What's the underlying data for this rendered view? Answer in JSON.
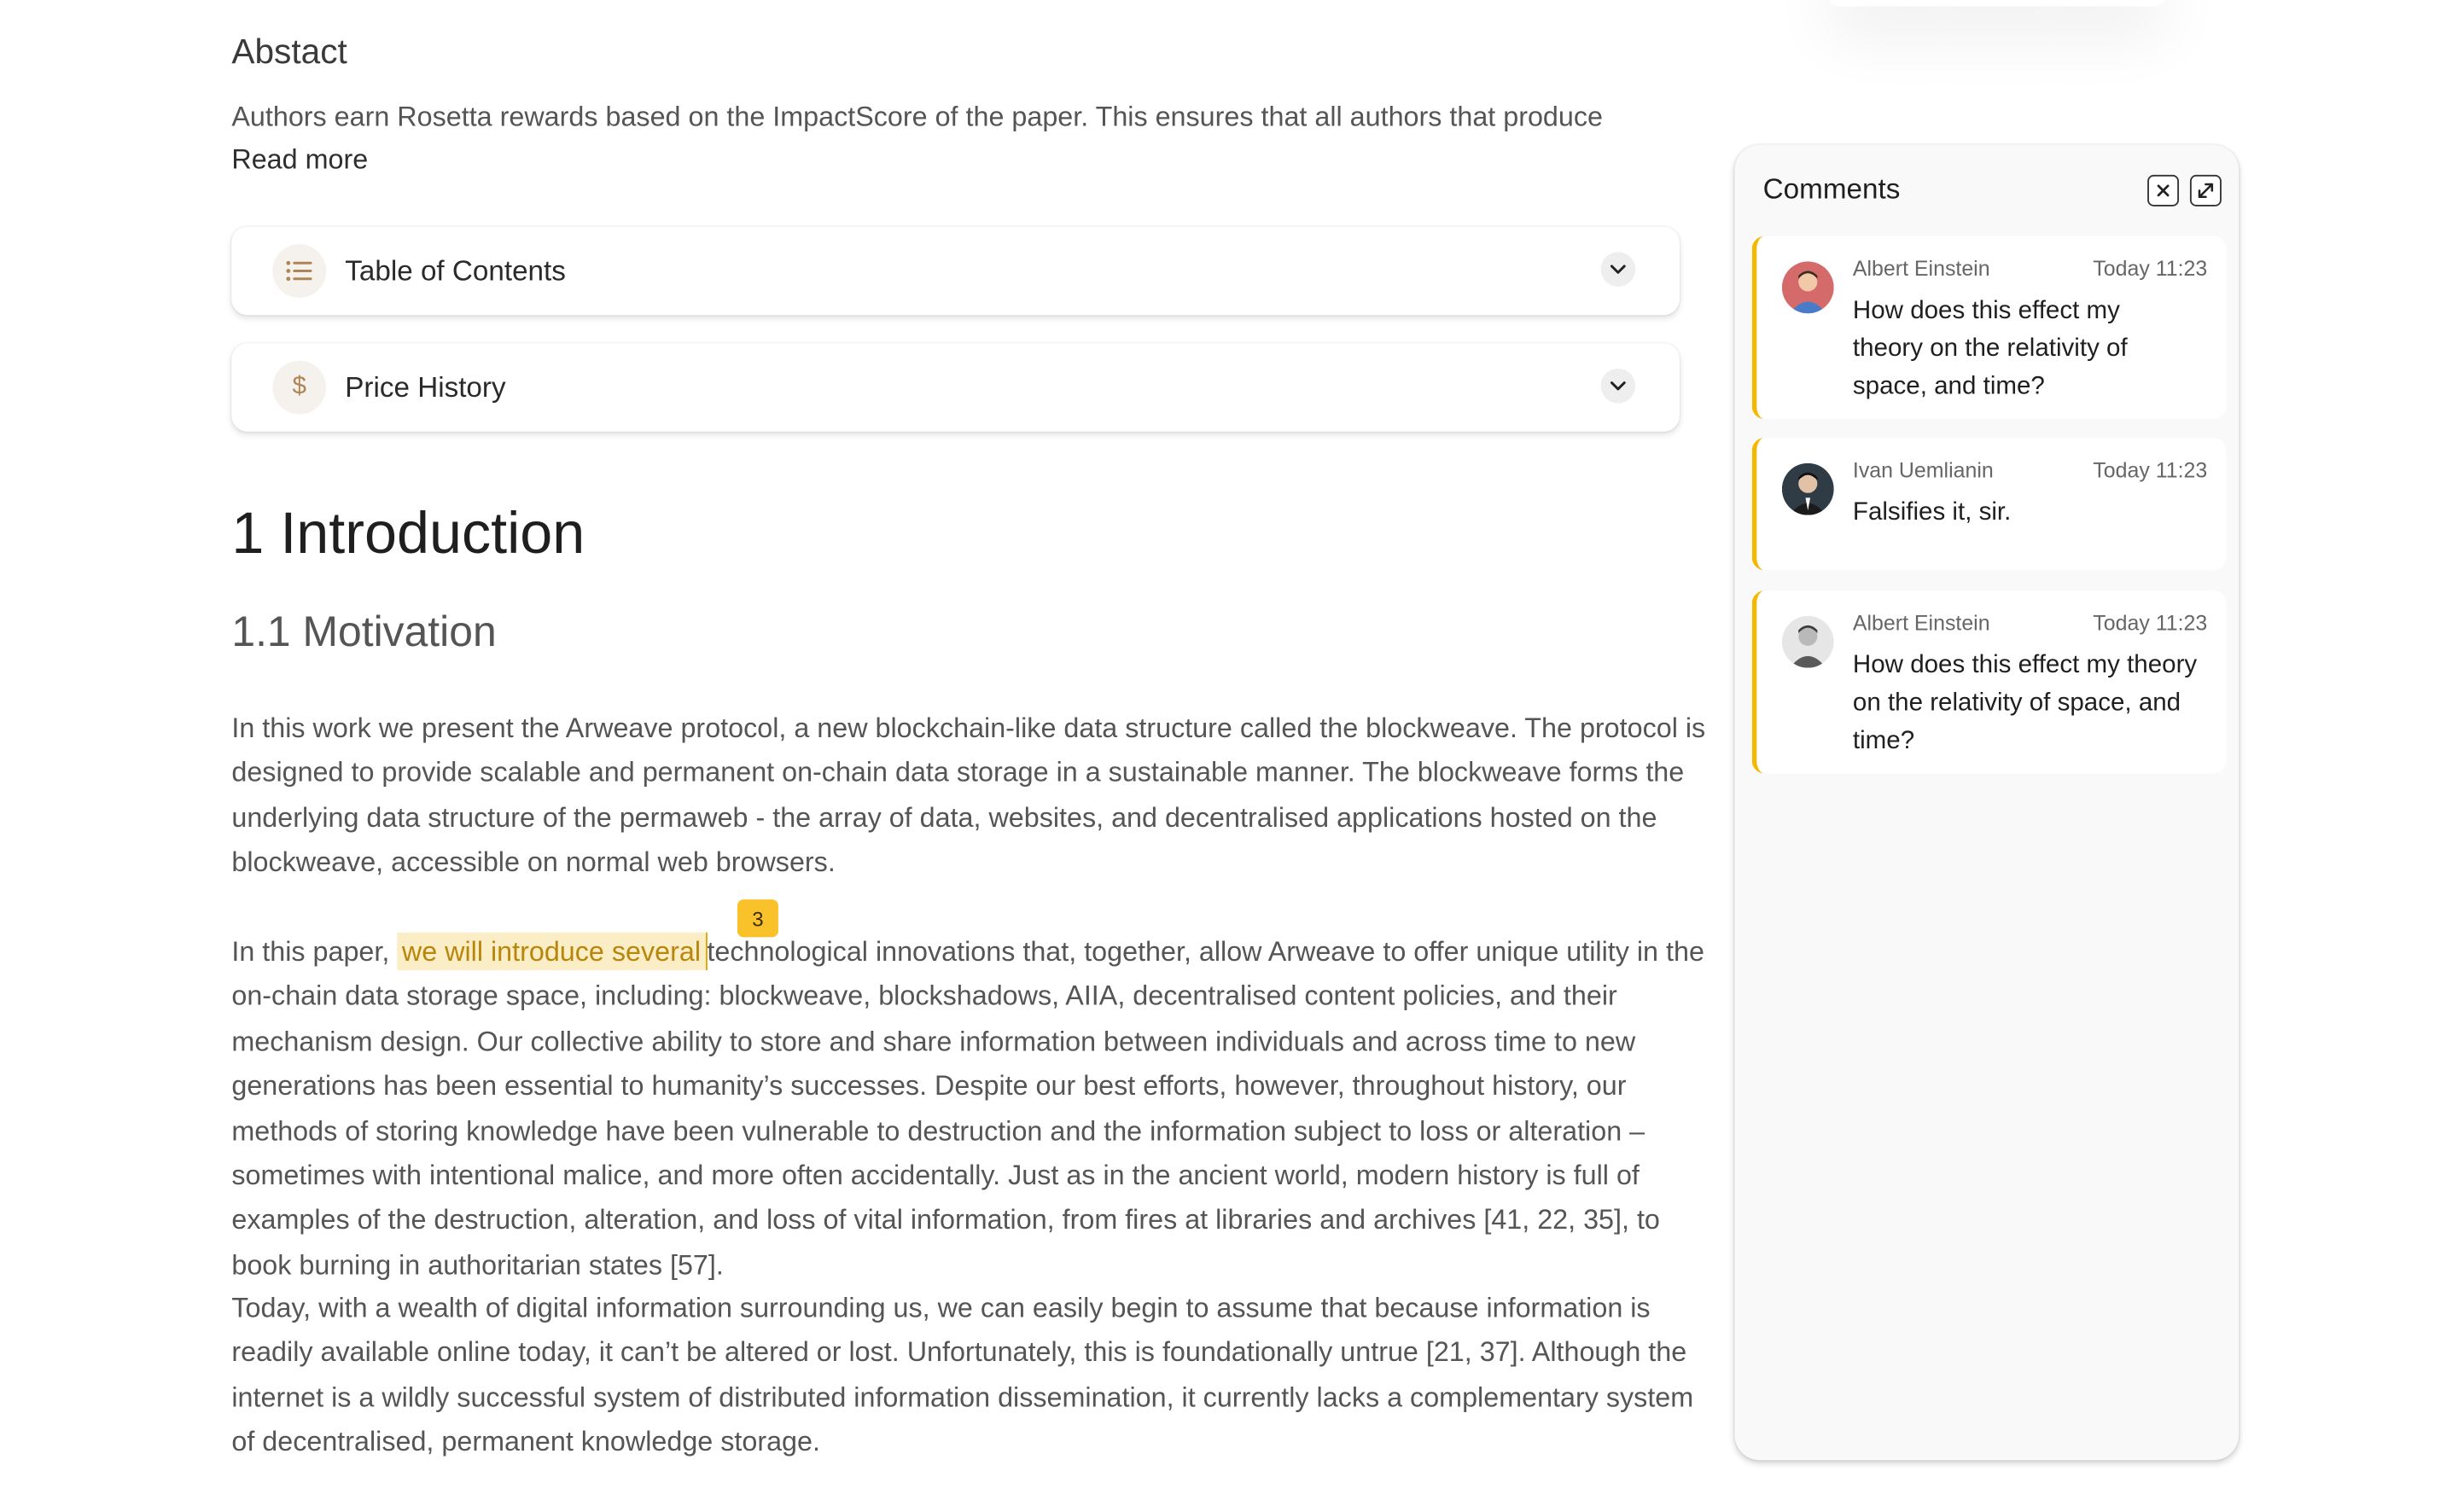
{
  "abstract": {
    "title": "Abstact",
    "text": "Authors earn Rosetta rewards based on the ImpactScore of the paper. This ensures that all authors that produce",
    "read_more": "Read more"
  },
  "accordions": [
    {
      "label": "Table of Contents",
      "icon": "list-icon"
    },
    {
      "label": "Price History",
      "icon": "dollar-icon",
      "icon_glyph": "$"
    }
  ],
  "article": {
    "heading": "1 Introduction",
    "subheading": "1.1 Motivation",
    "p1": "In this work we present the Arweave protocol, a new blockchain-like data structure called the blockweave. The protocol is designed to provide scalable and permanent on-chain data storage in a sustainable manner. The blockweave forms the underlying data structure of the permaweb - the array of data, websites, and decentralised applications hosted on the blockweave, accessible on normal web browsers.",
    "p2_before": "In this paper, ",
    "p2_highlight": "we will introduce several",
    "p2_after": "technological innovations that, together, allow Arweave to offer unique utility in the on-chain data storage space, including: blockweave, blockshadows, AIIA, decentralised content policies, and their mechanism design. Our collective ability to store and share information between individuals and across time to new generations has been essential to humanity’s successes. Despite our best efforts, however, throughout history, our methods of storing knowledge have been vulnerable to destruction and the information subject to loss or alteration – sometimes with intentional malice, and more often accidentally. Just as in the ancient world, modern history is full of examples of the destruction, alteration, and loss of vital information, from fires at libraries and archives [41, 22, 35], to book burning in authoritarian states [57].",
    "p3": "Today, with a wealth of digital information surrounding us, we can easily begin to assume that because information is readily available online today, it can’t be altered or lost. Unfortunately, this is foundationally untrue [21, 37]. Although the internet is a wildly successful system of distributed information dissemination, it currently lacks a complementary system of decentralised, permanent knowledge storage.",
    "comment_badge": "3"
  },
  "comments_panel": {
    "title": "Comments",
    "close_icon": "close-icon",
    "expand_icon": "expand-icon",
    "accent": "#f5b800",
    "items": [
      {
        "author": "Albert Einstein",
        "time": "Today 11:23",
        "text": "How does this effect my theory on the relativity of space, and time?"
      },
      {
        "author": "Ivan Uemlianin",
        "time": "Today 11:23",
        "text": "Falsifies it, sir."
      },
      {
        "author": "Albert Einstein",
        "time": "Today 11:23",
        "text": "How does this effect my theory on the relativity of space, and time?"
      }
    ]
  }
}
